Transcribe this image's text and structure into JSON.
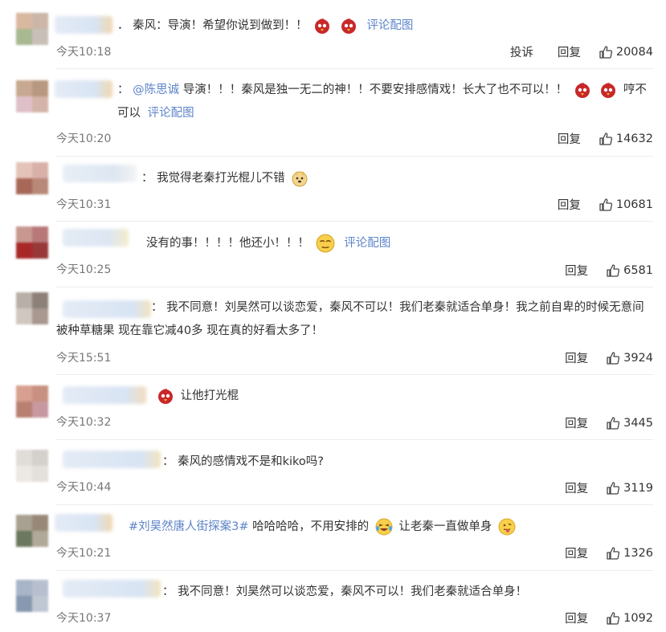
{
  "icons": {
    "like": "thumbs-up-icon",
    "angry_bird": "angry-bird-emoji",
    "doge": "doge-emoji",
    "sleepy": "sleepy-emoji",
    "laugh_cry": "laugh-cry-emoji",
    "tongue": "tongue-emoji"
  },
  "colors": {
    "link": "#5d84c9",
    "text": "#333333",
    "time": "#777777"
  },
  "comments": [
    {
      "prefix": "．",
      "text": "秦风：导演！希望你说到做到！！",
      "album": "评论配图",
      "time": "今天10:18",
      "report": "投诉",
      "reply": "回复",
      "likes": "20084"
    },
    {
      "prefix": "：",
      "mention": "@陈思诚",
      "text": "导演！！！秦风是独一无二的神！！不要安排感情戏！长大了也不可以！！",
      "text_tail": "哼不可以",
      "album": "评论配图",
      "time": "今天10:20",
      "reply": "回复",
      "likes": "14632"
    },
    {
      "prefix": "：",
      "text": "我觉得老秦打光棍儿不错",
      "time": "今天10:31",
      "reply": "回复",
      "likes": "10681"
    },
    {
      "text": "没有的事！！！！他还小！！！",
      "album": "评论配图",
      "time": "今天10:25",
      "reply": "回复",
      "likes": "6581"
    },
    {
      "prefix": "：",
      "text": "我不同意！刘昊然可以谈恋爱，秦风不可以！我们老秦就适合单身！我之前自卑的时候无意间被种草糖果 现在靠它减40多 现在真的好看太多了！",
      "time": "今天15:51",
      "reply": "回复",
      "likes": "3924"
    },
    {
      "text": "让他打光棍",
      "time": "今天10:32",
      "reply": "回复",
      "likes": "3445"
    },
    {
      "prefix": "：",
      "text": "秦风的感情戏不是和kiko吗?",
      "time": "今天10:44",
      "reply": "回复",
      "likes": "3119"
    },
    {
      "topic": "#刘昊然唐人街探案3#",
      "text": "哈哈哈哈，不用安排的",
      "text_tail": "让老秦一直做单身",
      "time": "今天10:21",
      "reply": "回复",
      "likes": "1326"
    },
    {
      "prefix": "：",
      "text": "我不同意！刘昊然可以谈恋爱，秦风不可以！我们老秦就适合单身！",
      "time": "今天10:37",
      "reply": "回复",
      "likes": "1092"
    }
  ]
}
